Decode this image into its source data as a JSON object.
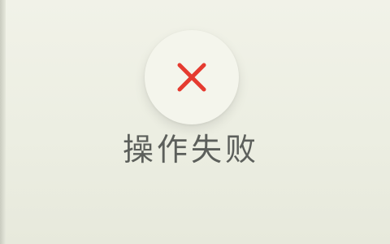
{
  "status": {
    "icon": "close-icon",
    "icon_color": "#e53b30",
    "message": "操作失败"
  }
}
